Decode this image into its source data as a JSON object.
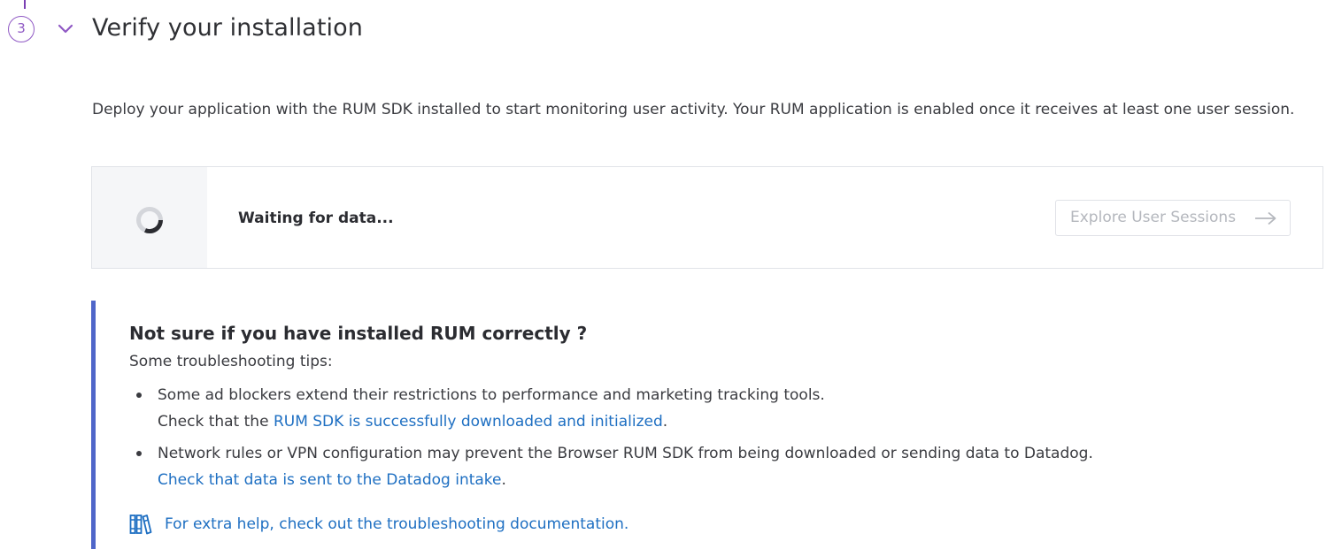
{
  "step": {
    "number": "3",
    "title": "Verify your installation"
  },
  "intro": "Deploy your application with the RUM SDK installed to start monitoring user activity. Your RUM application is enabled once it receives at least one user session.",
  "status": {
    "text": "Waiting for data...",
    "button_label": "Explore User Sessions"
  },
  "tips": {
    "title": "Not sure if you have installed RUM correctly ?",
    "subtitle": "Some troubleshooting tips:",
    "items": [
      {
        "text": "Some ad blockers extend their restrictions to performance and marketing tracking tools.",
        "prefix": "Check that the ",
        "link": "RUM SDK is successfully downloaded and initialized",
        "suffix": "."
      },
      {
        "text": "Network rules or VPN configuration may prevent the Browser RUM SDK from being downloaded or sending data to Datadog.",
        "prefix": "",
        "link": "Check that data is sent to the Datadog intake",
        "suffix": "."
      }
    ],
    "help_link": "For extra help, check out the troubleshooting documentation."
  },
  "colors": {
    "accent_purple": "#8f58c4",
    "link_blue": "#1e6fc2",
    "tips_border": "#4f66c9"
  },
  "icons": {
    "chevron": "chevron-down-icon",
    "spinner": "loading-spinner-icon",
    "arrow": "arrow-right-icon",
    "docs": "books-icon"
  }
}
